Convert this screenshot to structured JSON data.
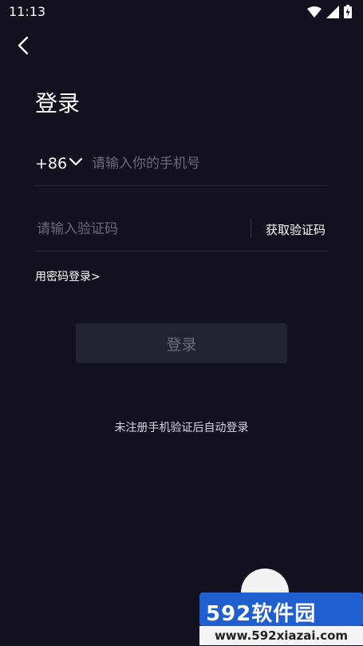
{
  "status_bar": {
    "time": "11:13",
    "icons": [
      "wifi-icon",
      "signal-icon",
      "battery-charging-icon"
    ]
  },
  "header": {
    "back_icon": "chevron-left-icon",
    "title": "登录"
  },
  "phone": {
    "country_code": "+86",
    "placeholder": "请输入你的手机号",
    "value": ""
  },
  "code": {
    "placeholder": "请输入验证码",
    "value": "",
    "get_code_label": "获取验证码"
  },
  "password_login_link": "用密码登录>",
  "login_button_label": "登录",
  "auto_register_note": "未注册手机验证后自动登录",
  "watermark": {
    "brand": "592软件园",
    "url": "www.592xiazai.com"
  },
  "colors": {
    "background": "#13111f",
    "button_disabled_bg": "#232231",
    "button_disabled_text": "#6e6c7c",
    "placeholder": "#6b6979",
    "divider": "#2a2838"
  }
}
